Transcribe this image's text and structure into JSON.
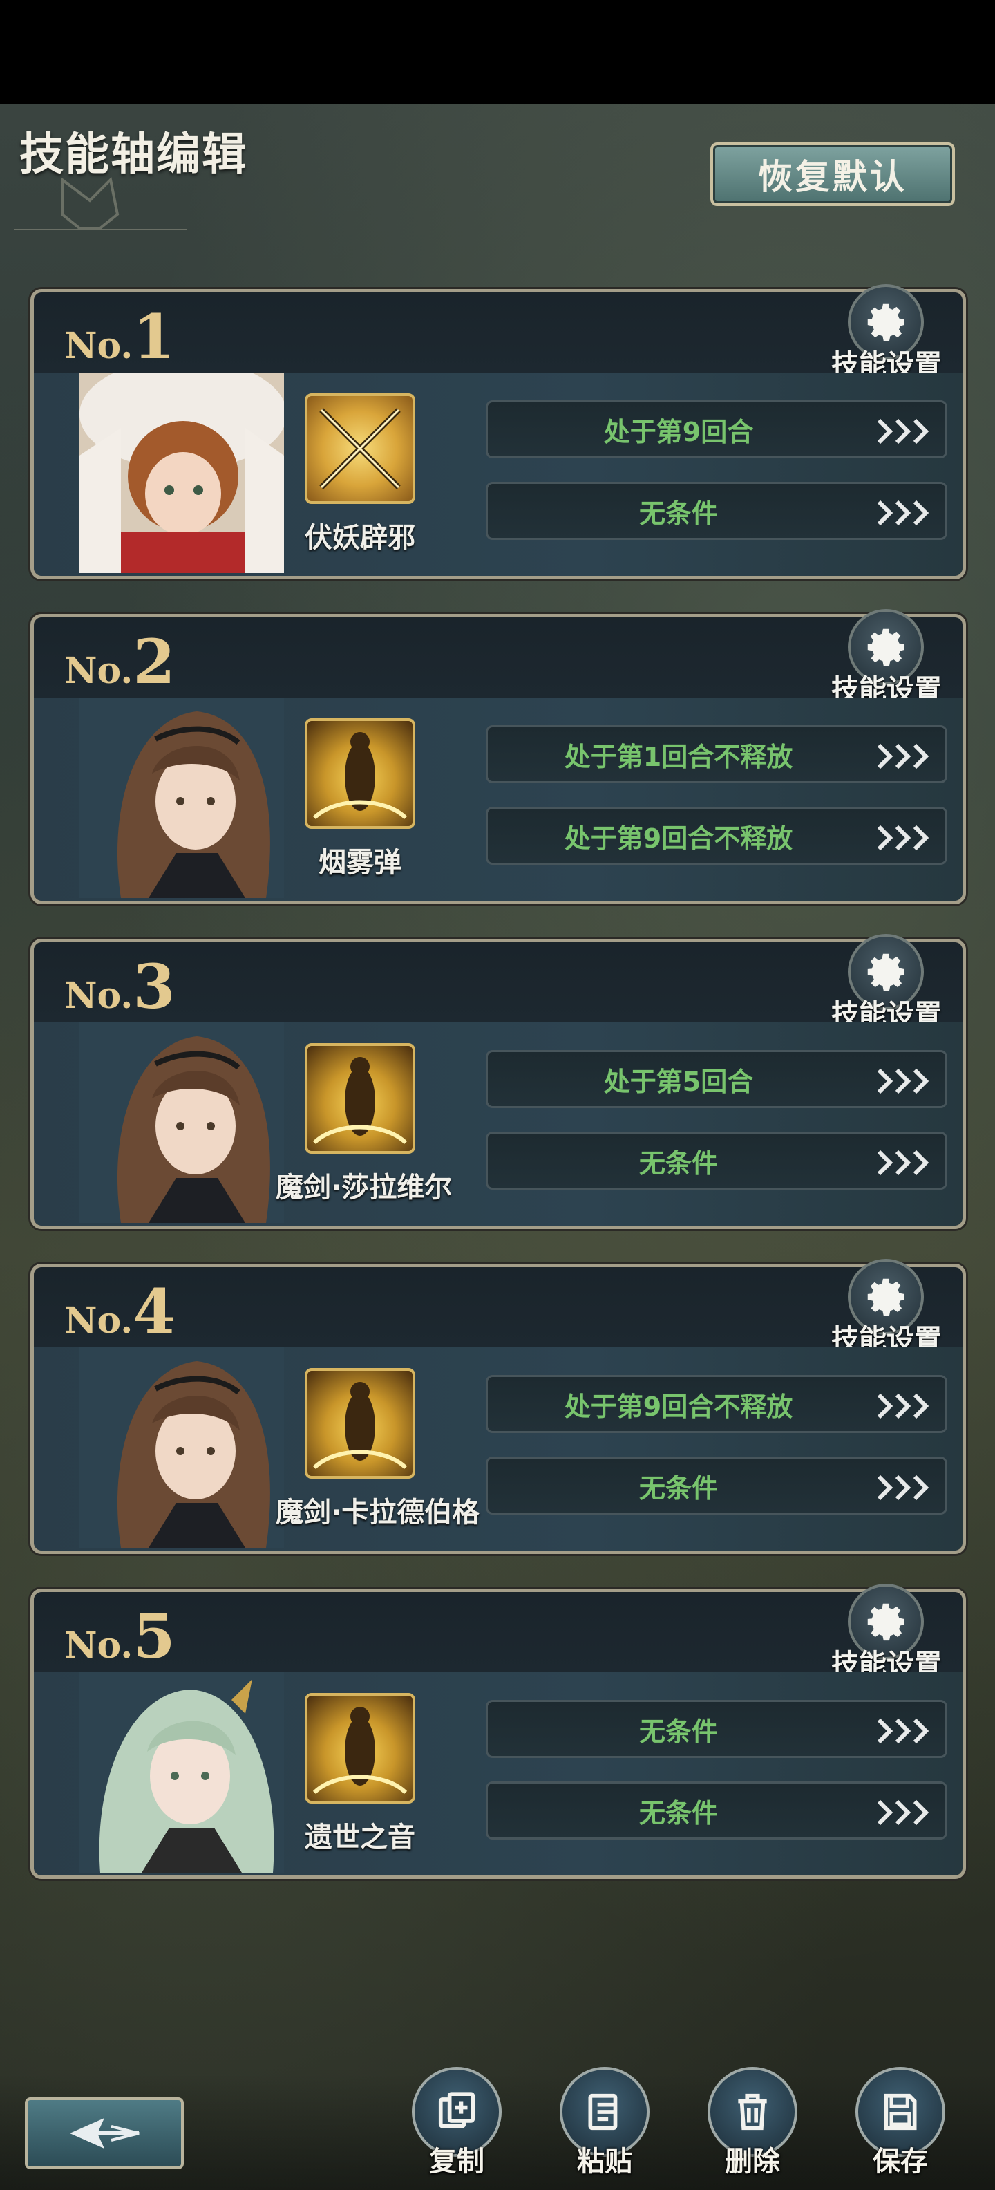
{
  "header": {
    "title": "技能轴编辑",
    "reset_label": "恢复默认"
  },
  "cards": [
    {
      "no": "No.",
      "num": "1",
      "settings_label": "技能设置",
      "skill_name": "伏妖辟邪",
      "conditions": [
        "处于第9回合",
        "无条件"
      ]
    },
    {
      "no": "No.",
      "num": "2",
      "settings_label": "技能设置",
      "skill_name": "烟雾弹",
      "conditions": [
        "处于第1回合不释放",
        "处于第9回合不释放"
      ]
    },
    {
      "no": "No.",
      "num": "3",
      "settings_label": "技能设置",
      "skill_name": "魔剑·莎拉维尔",
      "conditions": [
        "处于第5回合",
        "无条件"
      ]
    },
    {
      "no": "No.",
      "num": "4",
      "settings_label": "技能设置",
      "skill_name": "魔剑·卡拉德伯格",
      "conditions": [
        "处于第9回合不释放",
        "无条件"
      ]
    },
    {
      "no": "No.",
      "num": "5",
      "settings_label": "技能设置",
      "skill_name": "遗世之音",
      "conditions": [
        "无条件",
        "无条件"
      ]
    }
  ],
  "actions": {
    "copy": "复制",
    "paste": "粘贴",
    "delete": "删除",
    "save": "保存"
  },
  "colors": {
    "condition_text": "#78c46d",
    "card_number": "#e3c98f",
    "accent_button": "#5f8785"
  }
}
